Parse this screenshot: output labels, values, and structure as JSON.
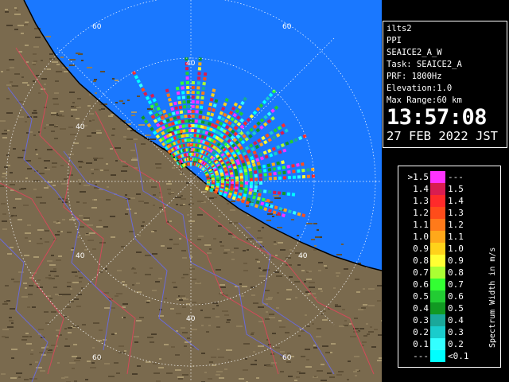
{
  "radar": {
    "site": "ilts2",
    "scan_type": "PPI",
    "product": "SEAICE2_A_W",
    "task": "Task: SEAICE2_A",
    "prf": "PRF: 1800Hz",
    "elevation": "Elevation:1.0",
    "max_range": "Max Range:60 km",
    "time": "13:57:08",
    "date": "27 FEB 2022 JST"
  },
  "range_labels": [
    "60",
    "60",
    "40",
    "40",
    "40",
    "40",
    "40",
    "60",
    "60"
  ],
  "legend": {
    "unit": "Spectrum Width in m/s",
    "rows": [
      {
        "lo": ">1.5",
        "hi": "---",
        "color": "#ff33ff"
      },
      {
        "lo": "1.4",
        "hi": "1.5",
        "color": "#d91c50"
      },
      {
        "lo": "1.3",
        "hi": "1.4",
        "color": "#ff2a2a"
      },
      {
        "lo": "1.2",
        "hi": "1.3",
        "color": "#ff4c1a"
      },
      {
        "lo": "1.1",
        "hi": "1.2",
        "color": "#ff7a1a"
      },
      {
        "lo": "1.0",
        "hi": "1.1",
        "color": "#ffa81a"
      },
      {
        "lo": "0.9",
        "hi": "1.0",
        "color": "#ffd21a"
      },
      {
        "lo": "0.8",
        "hi": "0.9",
        "color": "#ffff33"
      },
      {
        "lo": "0.7",
        "hi": "0.8",
        "color": "#aaff33"
      },
      {
        "lo": "0.6",
        "hi": "0.7",
        "color": "#33ff33"
      },
      {
        "lo": "0.5",
        "hi": "0.6",
        "color": "#22cc33"
      },
      {
        "lo": "0.4",
        "hi": "0.5",
        "color": "#119922"
      },
      {
        "lo": "0.3",
        "hi": "0.4",
        "color": "#1aa89a"
      },
      {
        "lo": "0.2",
        "hi": "0.3",
        "color": "#1acccc"
      },
      {
        "lo": "0.1",
        "hi": "0.2",
        "color": "#33ffff"
      },
      {
        "lo": "---",
        "hi": "<0.1",
        "color": "#00ffff"
      }
    ]
  },
  "colors": {
    "sea": "#1a78ff",
    "land": "#7a6a4e",
    "range_ring": "#ffffff",
    "border_line": "#d24a5a",
    "river_line": "#6a6ad8"
  }
}
